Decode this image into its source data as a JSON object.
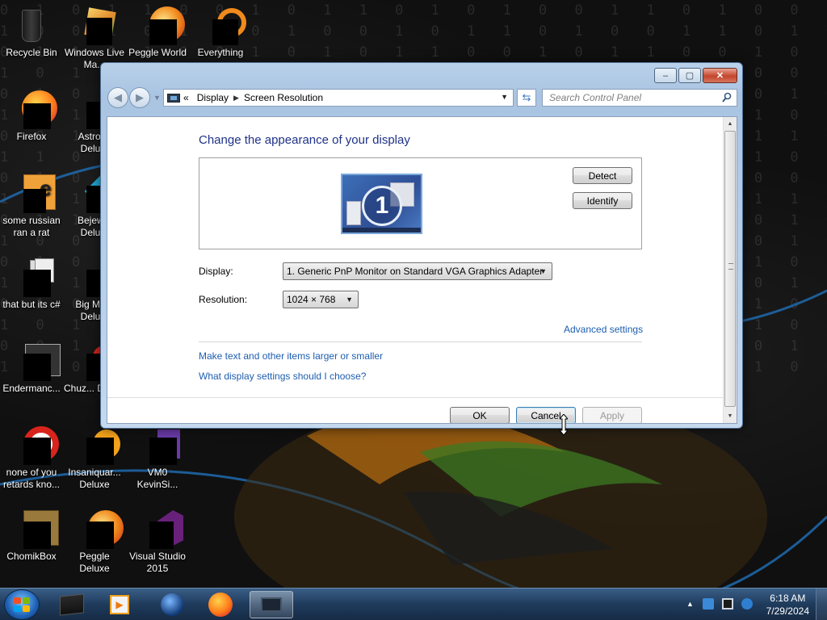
{
  "desktop": {
    "binary_rows": [
      "0 1 0 1 1 0 0 1 0 1 1 0 1 0 1 0 0 1 1 0 1 0 0 1 0 1 1 0 1",
      "1 0 0 1 0 1 1 0 1 0 0 1 0 1 1 0 1 0 0 1 1 0 1 0 1 0 0 1 0",
      "0 1 1 0 1 0 0 1 0 1 0 1 1 0 0 1 0 1 1 0 0 1 0 1 1 0 1 0 1",
      "1 0 1 1 0 0 1 0 1 0 1 0 0 1 0 1 1 0 1 0 1 0 0 1 0 1 1 0 0",
      "0 1 0 0 1 1 0 1 0 1 1 0 1 0 1 0 0 1 0 1 1 0 1 0 0 1 0 1 1",
      "1 0 1 0 1 0 1 1 0 0 1 0 1 1 0 1 0 0 1 0 1 1 0 1 0 0 1 0 1",
      "0 0 1 1 0 1 0 0 1 1 0 1 0 1 1 0 1 0 0 1 0 1 1 0 1 0 0 1 0",
      "1 1 0 0 1 0 1 0 0 1 1 0 1 0 0 1 1 0 1 0 0 1 0 1 1 0 1 0 1",
      "0 1 0 1 0 1 1 0 1 0 0 1 1 0 1 0 0 1 0 1 1 0 0 1 0 1 0 1 1",
      "1 0 1 0 0 1 0 1 1 0 1 0 0 1 0 1 1 0 0 1 0 1 1 0 1 0 1 0 0",
      "0 1 1 0 1 0 1 0 0 1 0 1 1 0 1 0 0 1 1 0 1 0 1 0 0 1 1 0 1",
      "1 0 0 1 0 1 0 1 1 0 1 1 0 0 1 0 1 0 1 1 0 0 1 0 1 1 0 1 0",
      "0 1 0 1 1 0 1 0 0 1 0 0 1 1 0 1 0 1 0 0 1 1 0 1 0 0 1 0 1",
      "1 0 1 0 0 1 0 1 1 0 1 0 1 0 1 1 0 0 1 0 1 0 1 1 0 1 0 1 0",
      "0 1 0 1 0 0 1 1 0 1 0 1 0 1 0 0 1 1 0 1 0 1 0 0 1 0 1 1 0",
      "1 0 1 1 0 1 0 0 1 0 1 0 1 1 0 1 0 0 1 1 0 1 0 1 0 1 0 0 1",
      "0 0 1 0 1 1 0 1 0 1 0 1 0 0 1 0 1 1 0 0 1 0 1 1 0 1 1 0 1",
      "1 1 0 1 0 0 1 0 1 0 1 1 0 1 0 1 0 0 1 1 0 1 0 0 1 0 0 1 0"
    ],
    "icons": [
      {
        "name": "recycle-bin",
        "label": "Recycle Bin"
      },
      {
        "name": "windows-live-movie-maker",
        "label": "Windows Live Ma..."
      },
      {
        "name": "peggle-world",
        "label": "Peggle World"
      },
      {
        "name": "everything",
        "label": "Everything"
      },
      {
        "name": "firefox",
        "label": "Firefox"
      },
      {
        "name": "astropop-deluxe",
        "label": "Astrol... Delu..."
      },
      {
        "name": "some-russian-ran-a-rat",
        "label": "some russian ran a rat"
      },
      {
        "name": "bejeweled-deluxe",
        "label": "Bejew... Delu..."
      },
      {
        "name": "that-but-its-csharp",
        "label": "that but its c#"
      },
      {
        "name": "big-money-deluxe",
        "label": "Big Mo... Delu..."
      },
      {
        "name": "endermanch",
        "label": "Endermanc..."
      },
      {
        "name": "chuzzle-deluxe",
        "label": "Chuz... Delu..."
      },
      {
        "name": "none-of-you",
        "label": "none of you retards kno..."
      },
      {
        "name": "insaniquarium-deluxe",
        "label": "Insaniquar... Deluxe"
      },
      {
        "name": "vm0-kevinsi",
        "label": "VM0 KevinSi..."
      },
      {
        "name": "chomikbox",
        "label": "ChomikBox"
      },
      {
        "name": "peggle-deluxe",
        "label": "Peggle Deluxe"
      },
      {
        "name": "visual-studio-2015",
        "label": "Visual Studio 2015"
      }
    ]
  },
  "window": {
    "breadcrumb": {
      "prefix": "«",
      "items": [
        "Display",
        "Screen Resolution"
      ]
    },
    "search_placeholder": "Search Control Panel",
    "caption_buttons": {
      "minimize": "–",
      "maximize": "▢",
      "close": "✕"
    },
    "title": "Change the appearance of your display",
    "monitor_number": "1",
    "detect_label": "Detect",
    "identify_label": "Identify",
    "display_label": "Display:",
    "display_value": "1. Generic PnP Monitor on Standard VGA Graphics Adapter",
    "resolution_label": "Resolution:",
    "resolution_value": "1024 × 768",
    "advanced_link": "Advanced settings",
    "link_text_size": "Make text and other items larger or smaller",
    "link_display_help": "What display settings should I choose?",
    "ok_label": "OK",
    "cancel_label": "Cancel",
    "apply_label": "Apply"
  },
  "taskbar": {
    "clock_time": "6:18 AM",
    "clock_date": "7/29/2024"
  },
  "colors": {
    "accent": "#1d5eb0",
    "title": "#1e3287",
    "taskbar": "#1f3b5c"
  }
}
